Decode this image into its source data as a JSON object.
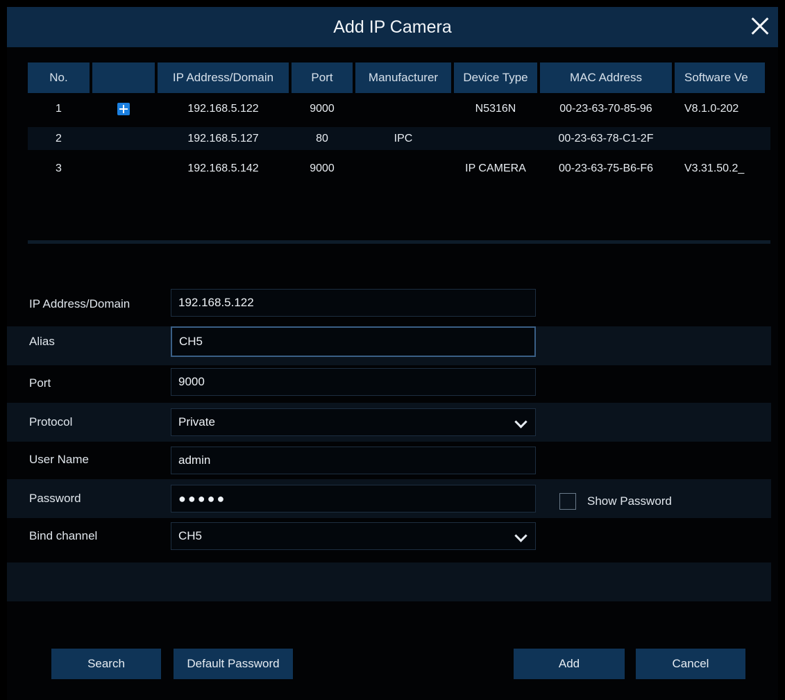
{
  "dialog": {
    "title": "Add IP Camera"
  },
  "table": {
    "headers": [
      "No.",
      "",
      "IP Address/Domain",
      "Port",
      "Manufacturer",
      "Device Type",
      "MAC Address",
      "Software Ve"
    ],
    "rows": [
      {
        "no": "1",
        "added": true,
        "ip": "192.168.5.122",
        "port": "9000",
        "manufacturer": "",
        "device_type": "N5316N",
        "mac": "00-23-63-70-85-96",
        "software": "V8.1.0-202"
      },
      {
        "no": "2",
        "added": false,
        "ip": "192.168.5.127",
        "port": "80",
        "manufacturer": "IPC",
        "device_type": "",
        "mac": "00-23-63-78-C1-2F",
        "software": ""
      },
      {
        "no": "3",
        "added": false,
        "ip": "192.168.5.142",
        "port": "9000",
        "manufacturer": "",
        "device_type": "IP CAMERA",
        "mac": "00-23-63-75-B6-F6",
        "software": "V3.31.50.2_"
      }
    ]
  },
  "form": {
    "ip_label": "IP Address/Domain",
    "ip_value": "192.168.5.122",
    "alias_label": "Alias",
    "alias_value": "CH5",
    "port_label": "Port",
    "port_value": "9000",
    "protocol_label": "Protocol",
    "protocol_value": "Private",
    "username_label": "User Name",
    "username_value": "admin",
    "password_label": "Password",
    "password_value": "●●●●●",
    "show_password_label": "Show Password",
    "bind_label": "Bind channel",
    "bind_value": "CH5"
  },
  "buttons": {
    "search": "Search",
    "default_password": "Default Password",
    "add": "Add",
    "cancel": "Cancel"
  },
  "colors": {
    "titlebar": "#0d2a47",
    "button": "#0f3457",
    "plus": "#1a7fe0"
  }
}
